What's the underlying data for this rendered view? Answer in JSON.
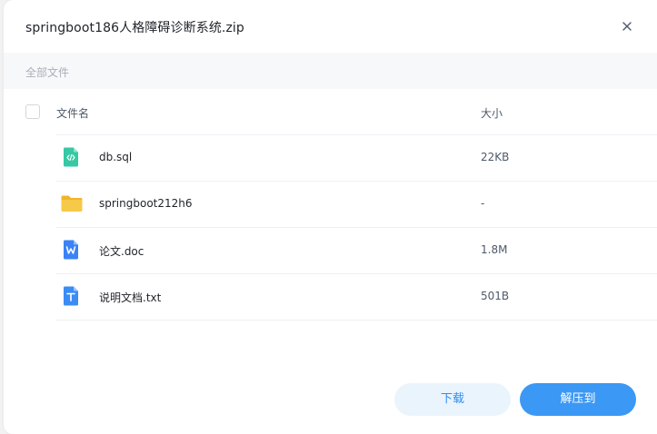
{
  "dialog": {
    "title": "springboot186人格障碍诊断系统.zip",
    "close_icon": "close-icon"
  },
  "breadcrumb": {
    "label": "全部文件"
  },
  "table": {
    "headers": {
      "name": "文件名",
      "size": "大小"
    },
    "rows": [
      {
        "icon": "sql-file-icon",
        "icon_color": "#36c9a3",
        "name": "db.sql",
        "size": "22KB"
      },
      {
        "icon": "folder-icon",
        "icon_color": "#f7c33c",
        "name": "springboot212h6",
        "size": "-"
      },
      {
        "icon": "word-doc-icon",
        "icon_color": "#3b82f6",
        "name": "论文.doc",
        "size": "1.8M"
      },
      {
        "icon": "text-file-icon",
        "icon_color": "#3b8cf5",
        "name": "说明文档.txt",
        "size": "501B"
      }
    ]
  },
  "actions": {
    "download_label": "下载",
    "extract_label": "解压到"
  },
  "colors": {
    "accent": "#3b98f5",
    "accent_light": "#eaf4fd"
  }
}
